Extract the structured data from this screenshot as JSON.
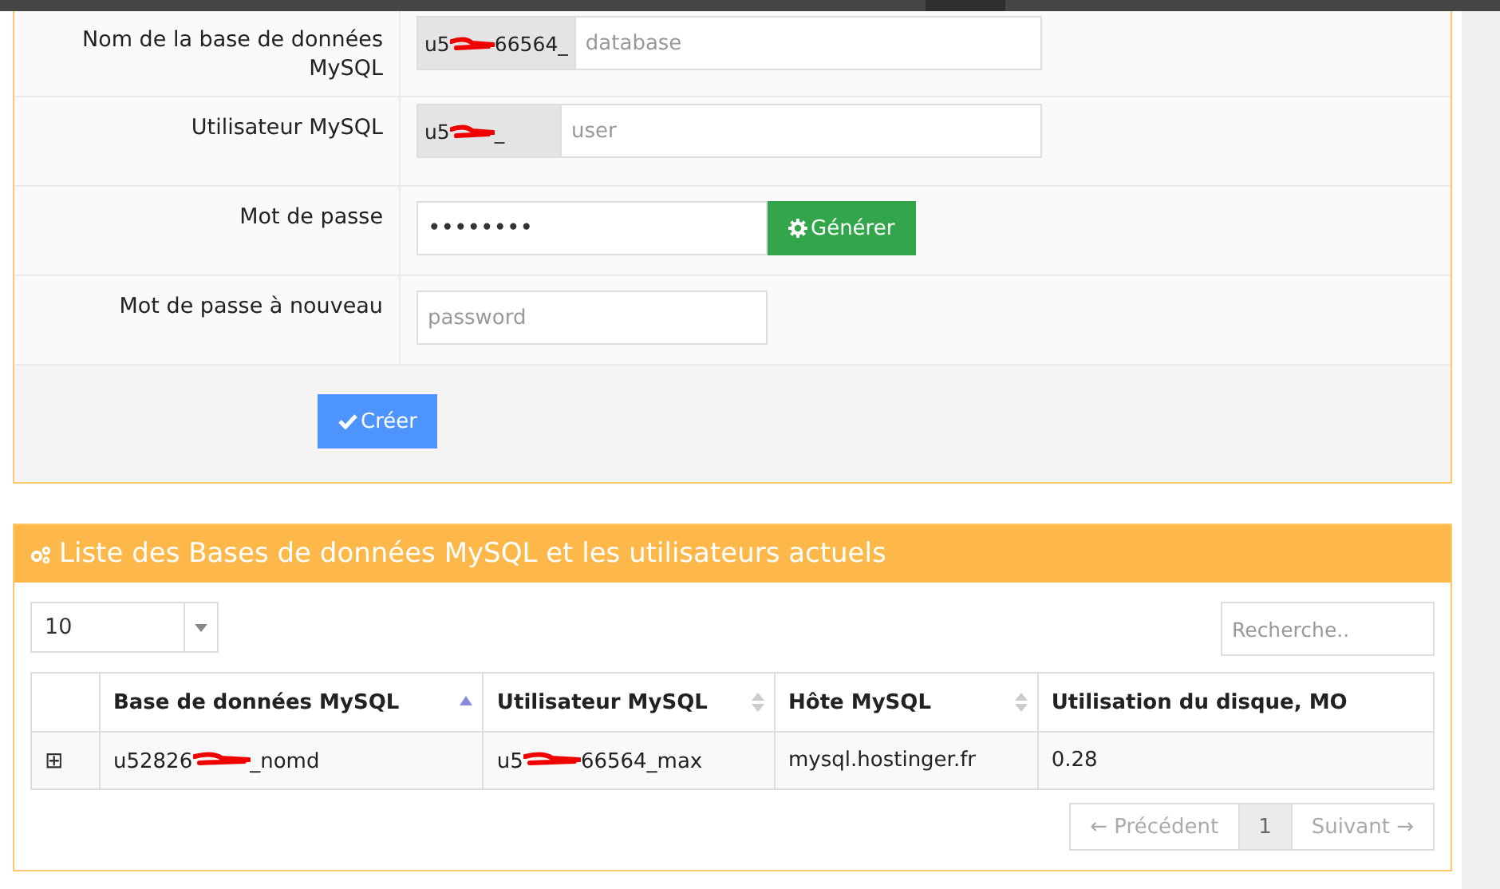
{
  "form": {
    "rows": [
      {
        "kind": "prefixed",
        "label": "Nom de la base de données MySQL",
        "prefix_parts": [
          "u5",
          "66564_"
        ],
        "placeholder": "database"
      },
      {
        "kind": "prefixed",
        "label": "Utilisateur MySQL",
        "prefix_parts": [
          "u5",
          "_"
        ],
        "placeholder": "user"
      },
      {
        "kind": "password",
        "label": "Mot de passe",
        "value": "••••••••",
        "button": "Générer"
      },
      {
        "kind": "plain",
        "label": "Mot de passe à nouveau",
        "placeholder": "password"
      }
    ],
    "submit": "Créer"
  },
  "list": {
    "title": "Liste des Bases de données MySQL et les utilisateurs actuels",
    "page_size": "10",
    "search_placeholder": "Recherche..",
    "columns": [
      {
        "label": "Base de données MySQL",
        "kind": "sorted-asc"
      },
      {
        "label": "Utilisateur MySQL",
        "kind": "sortable"
      },
      {
        "label": "Hôte MySQL",
        "kind": "sortable"
      },
      {
        "label": "Utilisation du disque, MO",
        "kind": "plain"
      }
    ],
    "rows": [
      {
        "expand": "⊞",
        "cells": [
          {
            "parts": [
              "u52826",
              "_nomd"
            ]
          },
          {
            "parts": [
              "u5",
              "66564_max"
            ]
          },
          {
            "parts": [
              "mysql.hostinger.fr"
            ]
          },
          {
            "parts": [
              "0.28"
            ]
          }
        ]
      }
    ],
    "pagination": [
      {
        "label": "← Précédent",
        "selected": false
      },
      {
        "label": "1",
        "selected": true
      },
      {
        "label": "Suivant →",
        "selected": false
      }
    ]
  }
}
